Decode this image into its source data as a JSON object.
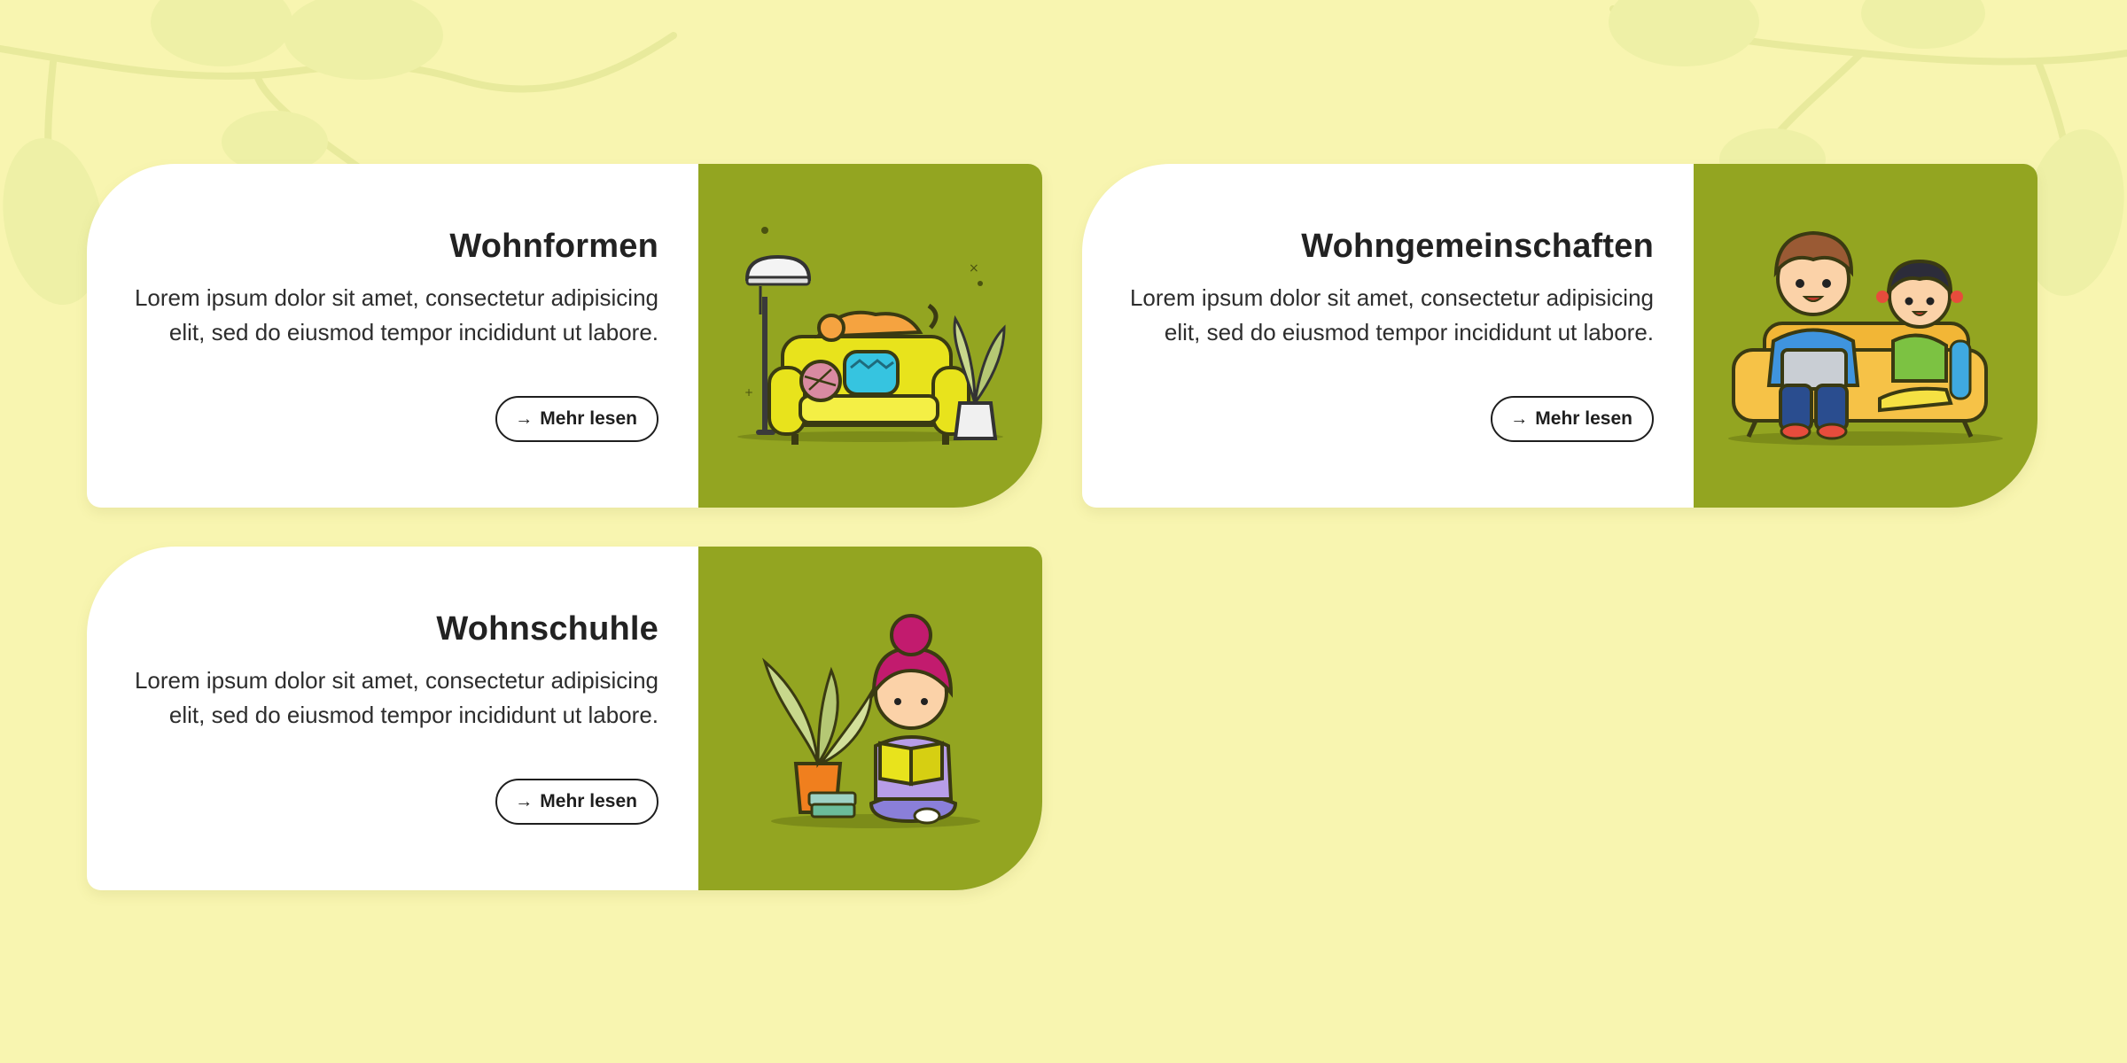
{
  "cards": [
    {
      "title": "Wohnformen",
      "description": "Lorem ipsum dolor sit amet, consectetur adipisicing elit, sed do eiusmod tempor incididunt ut labore.",
      "button_label": "Mehr lesen",
      "illustration": "armchair-cat-lamp-plant"
    },
    {
      "title": "Wohngemeinschaften",
      "description": "Lorem ipsum dolor sit amet, consectetur adipisicing elit, sed do eiusmod tempor incididunt ut labore.",
      "button_label": "Mehr lesen",
      "illustration": "boy-and-girl-on-sofa"
    },
    {
      "title": "Wohnschuhle",
      "description": "Lorem ipsum dolor sit amet, consectetur adipisicing elit, sed do eiusmod tempor incididunt ut labore.",
      "button_label": "Mehr lesen",
      "illustration": "girl-reading-book-plant"
    }
  ],
  "icons": {
    "button_arrow": "→"
  },
  "colors": {
    "page_background": "#f8f5b0",
    "card_background": "#ffffff",
    "media_background": "#93a521",
    "text": "#222222",
    "button_border": "#1e1e1e"
  }
}
